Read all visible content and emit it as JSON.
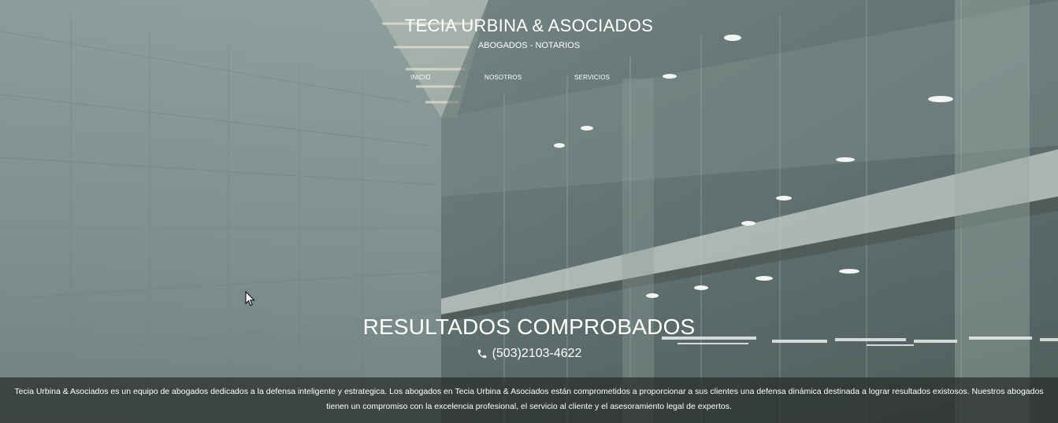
{
  "header": {
    "title": "TECIA URBINA & ASOCIADOS",
    "subtitle": "ABOGADOS - NOTARIOS"
  },
  "nav": {
    "items": [
      {
        "label": "INICIO"
      },
      {
        "label": "NOSOTROS"
      },
      {
        "label": "SERVICIOS"
      }
    ]
  },
  "hero": {
    "heading": "RESULTADOS COMPROBADOS",
    "phone": "(503)2103-4622",
    "phone_icon": "phone-icon",
    "background": "concrete corridor with glass wall"
  },
  "about": {
    "text": "Tecia Urbina & Asociados es un equipo de abogados dedicados a la defensa inteligente y estrategica. Los abogados en Tecia Urbina & Asociados están comprometidos a proporcionar a sus clientes una defensa dinámica destinada a lograr resultados existosos. Nuestros abogados tienen un compromiso con la excelencia profesional, el servicio al cliente y el asesoramiento legal de expertos."
  },
  "colors": {
    "text": "#ffffff",
    "overlay": "#2c3030"
  }
}
